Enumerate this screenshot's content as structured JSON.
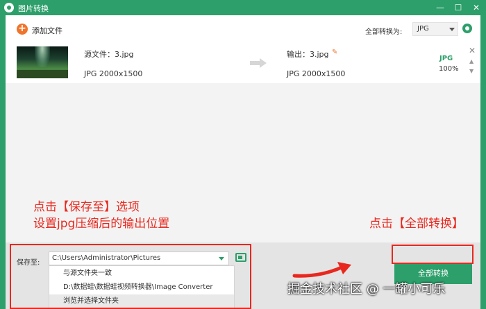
{
  "window": {
    "title": "图片转换",
    "minimize_glyph": "—",
    "maximize_glyph": "☐",
    "close_glyph": "✕"
  },
  "toolbar": {
    "add_icon_glyph": "+",
    "add_label": "添加文件",
    "convert_all_label": "全部转换为:",
    "format_value": "JPG"
  },
  "file": {
    "source_name": "源文件：3.jpg",
    "source_meta": "JPG   2000x1500",
    "output_name": "输出：3.jpg",
    "output_meta": "JPG   2000x1500",
    "format_badge": "JPG",
    "progress": "100%",
    "progress_value": 1.0,
    "close_glyph": "✕",
    "up_glyph": "▲",
    "down_glyph": "▼",
    "edit_glyph": "✎"
  },
  "annotations": {
    "line1": "点击【保存至】选项",
    "line2": "设置jpg压缩后的输出位置",
    "right": "点击【全部转换】"
  },
  "bottom": {
    "save_label": "保存至:",
    "path_value": "C:\\Users\\Administrator\\Pictures",
    "dropdown_options": [
      "与源文件夹一致",
      "D:\\数据蛙\\数据蛙视频转换器\\Image Converter",
      "浏览并选择文件夹"
    ],
    "convert_button": "全部转换"
  },
  "watermark": "掘金技术社区 @ 一罐小可乐",
  "colors": {
    "accent": "#2d9f6a",
    "orange": "#f0742a",
    "annotation_red": "#e8281e"
  },
  "icons": [
    "app-logo-icon",
    "add-icon",
    "gear-icon",
    "edit-icon",
    "folder-icon",
    "chevron-down-icon",
    "close-icon",
    "arrow-right-icon",
    "curved-arrow-icon"
  ]
}
